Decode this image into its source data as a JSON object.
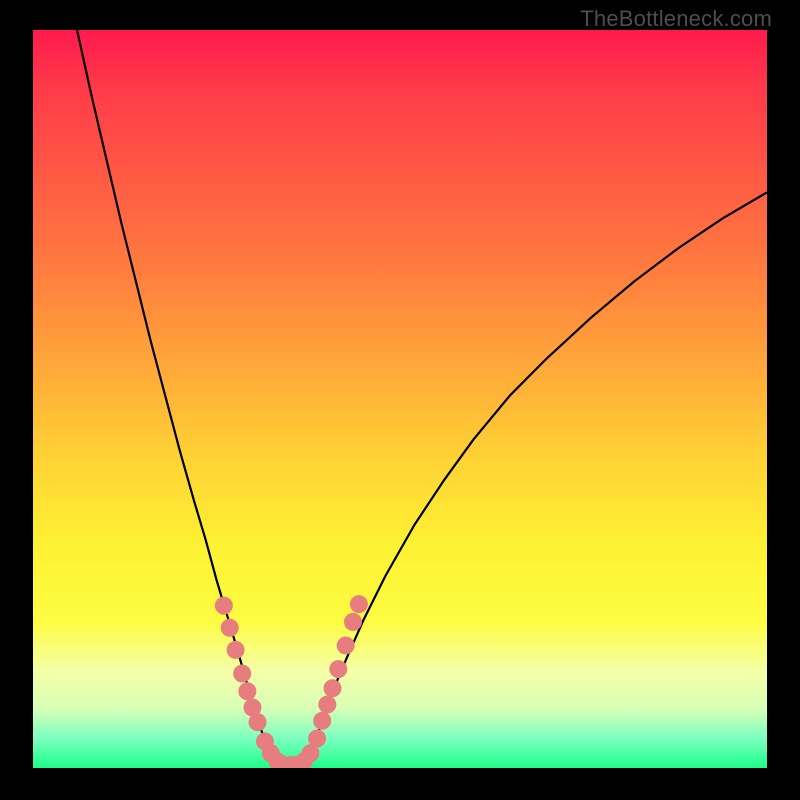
{
  "watermark": "TheBottleneck.com",
  "chart_data": {
    "type": "line",
    "title": "",
    "xlabel": "",
    "ylabel": "",
    "xlim": [
      0,
      100
    ],
    "ylim": [
      0,
      100
    ],
    "series": [
      {
        "name": "left-curve",
        "x": [
          6,
          8,
          10,
          12,
          14,
          16,
          18,
          20,
          22,
          23.5,
          25,
          26.5,
          28,
          29,
          30,
          30.8,
          31.5,
          32.2,
          33,
          33.5,
          34
        ],
        "y": [
          100,
          91,
          82.5,
          74,
          66,
          58,
          50.5,
          43,
          36,
          31,
          25.5,
          20.5,
          15.5,
          12,
          8.5,
          6,
          4,
          2.5,
          1.2,
          0.5,
          0
        ]
      },
      {
        "name": "right-curve",
        "x": [
          36,
          36.5,
          37,
          37.8,
          38.5,
          39.3,
          40,
          41.5,
          43,
          45,
          48,
          52,
          56,
          60,
          65,
          70,
          76,
          82,
          88,
          94,
          100
        ],
        "y": [
          0,
          0.5,
          1.2,
          2.5,
          4,
          6,
          8,
          12,
          15.5,
          20,
          26,
          33,
          39,
          44.5,
          50.5,
          55.5,
          61,
          66,
          70.5,
          74.5,
          78
        ]
      }
    ],
    "annotations": {
      "marker_color": "#e77d7e",
      "markers": [
        {
          "x": 26.0,
          "y": 22.0
        },
        {
          "x": 26.8,
          "y": 19.0
        },
        {
          "x": 27.6,
          "y": 16.0
        },
        {
          "x": 28.5,
          "y": 12.8
        },
        {
          "x": 29.2,
          "y": 10.4
        },
        {
          "x": 29.9,
          "y": 8.2
        },
        {
          "x": 30.6,
          "y": 6.2
        },
        {
          "x": 31.6,
          "y": 3.6
        },
        {
          "x": 32.4,
          "y": 2.0
        },
        {
          "x": 33.3,
          "y": 0.9
        },
        {
          "x": 34.2,
          "y": 0.4
        },
        {
          "x": 35.1,
          "y": 0.4
        },
        {
          "x": 36.0,
          "y": 0.4
        },
        {
          "x": 36.9,
          "y": 0.9
        },
        {
          "x": 37.8,
          "y": 2.0
        },
        {
          "x": 38.7,
          "y": 4.0
        },
        {
          "x": 39.4,
          "y": 6.4
        },
        {
          "x": 40.1,
          "y": 8.6
        },
        {
          "x": 40.8,
          "y": 10.8
        },
        {
          "x": 41.6,
          "y": 13.4
        },
        {
          "x": 42.6,
          "y": 16.6
        },
        {
          "x": 43.6,
          "y": 19.8
        },
        {
          "x": 44.4,
          "y": 22.2
        }
      ]
    }
  }
}
